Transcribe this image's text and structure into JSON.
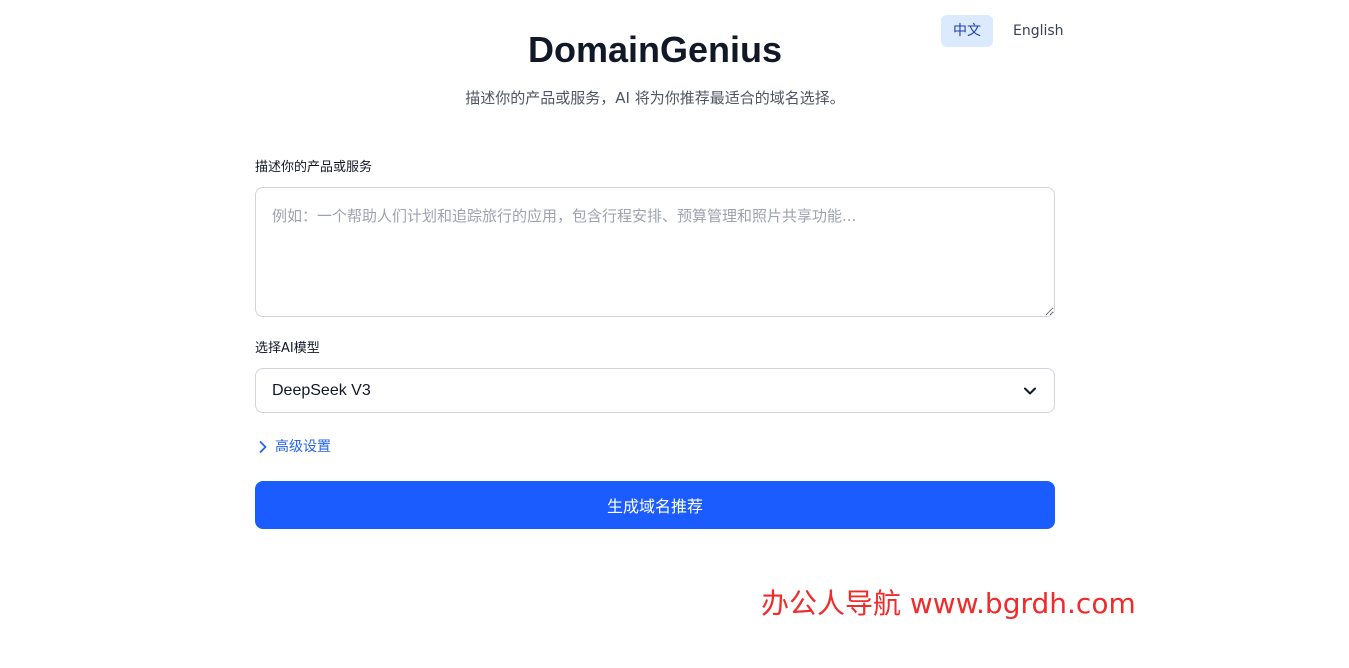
{
  "language_switch": {
    "zh_label": "中文",
    "en_label": "English",
    "active": "zh"
  },
  "header": {
    "title": "DomainGenius",
    "subtitle": "描述你的产品或服务，AI 将为你推荐最适合的域名选择。"
  },
  "form": {
    "description_label": "描述你的产品或服务",
    "description_value": "",
    "description_placeholder": "例如：一个帮助人们计划和追踪旅行的应用，包含行程安排、预算管理和照片共享功能...",
    "model_label": "选择AI模型",
    "model_selected": "DeepSeek V3",
    "advanced_label": "高级设置",
    "submit_label": "生成域名推荐"
  },
  "watermark": {
    "text": "办公人导航 www.bgrdh.com"
  },
  "icons": {
    "model_dropdown": "chevron-down-icon",
    "advanced_toggle": "chevron-right-icon"
  },
  "colors": {
    "primary": "#1a5cff",
    "link": "#2563eb",
    "active_lang_bg": "#dbeafe",
    "watermark": "#ef2b2b"
  }
}
